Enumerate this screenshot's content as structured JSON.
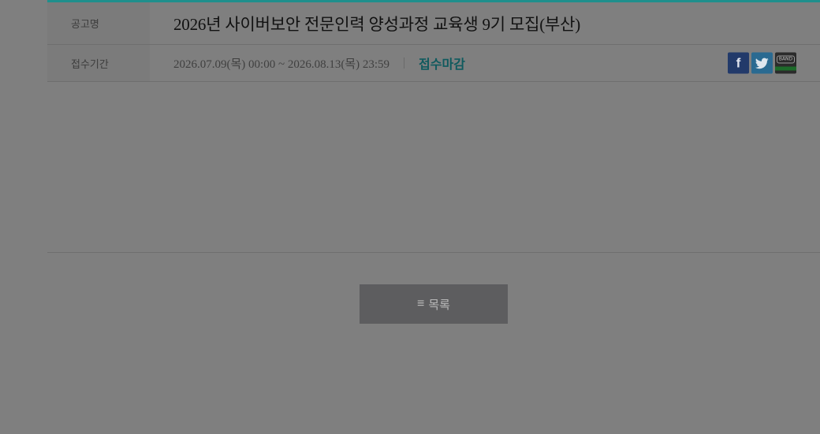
{
  "notice": {
    "title_label": "공고명",
    "title": "2026년 사이버보안 전문인력 양성과정 교육생 9기 모집(부산)",
    "period_label": "접수기간",
    "period": "2026.07.09(목) 00:00 ~ 2026.08.13(목) 23:59",
    "status": "접수마감"
  },
  "share": {
    "facebook_glyph": "f",
    "band_label": "BAND",
    "icons": [
      "facebook-icon",
      "twitter-icon",
      "band-icon"
    ]
  },
  "list_button": {
    "icon_glyph": "≡",
    "label": "목록"
  },
  "colors": {
    "accent": "#1f8f8c",
    "status": "#0f5a5e",
    "overlay_background": "#7f7f7f"
  }
}
